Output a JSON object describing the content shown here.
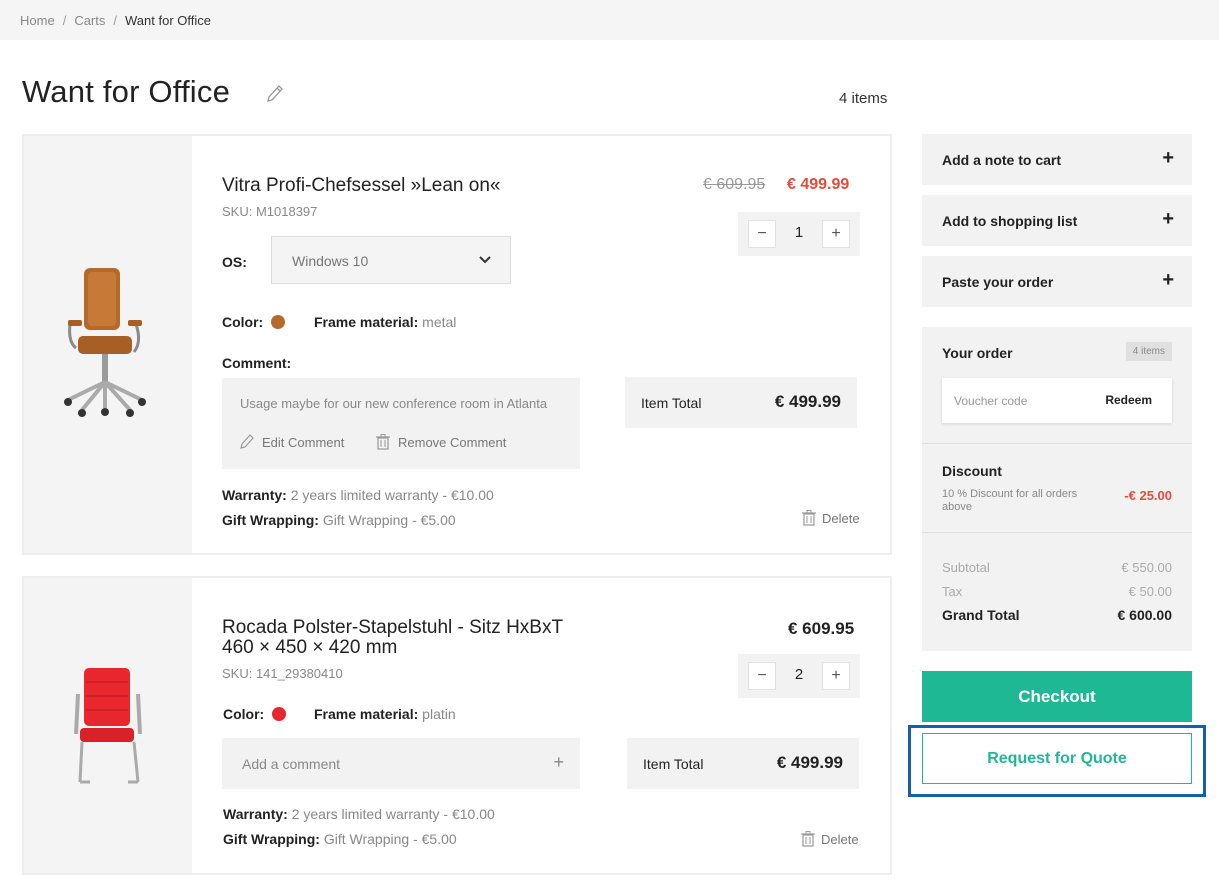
{
  "breadcrumb": [
    "Home",
    "Carts",
    "Want for Office"
  ],
  "page": {
    "title": "Want for Office",
    "items_count": "4 items"
  },
  "items": [
    {
      "name": "Vitra Profi-Chefsessel »Lean on«",
      "sku": "SKU: M1018397",
      "price_old": "€ 609.95",
      "price": "€ 499.99",
      "qty": "1",
      "os_label": "OS:",
      "os_value": "Windows 10",
      "color_label": "Color:",
      "color_hex": "#b5692a",
      "frame_label": "Frame material:",
      "frame_value": "metal",
      "comment_label": "Comment:",
      "comment_text": "Usage maybe for our new conference room in Atlanta",
      "edit_comment": "Edit Comment",
      "remove_comment": "Remove Comment",
      "item_total_label": "Item Total",
      "item_total": "€ 499.99",
      "warranty_label": "Warranty:",
      "warranty_value": "2 years limited warranty - €10.00",
      "gift_label": "Gift Wrapping:",
      "gift_value": "Gift Wrapping - €5.00",
      "delete": "Delete"
    },
    {
      "name_line1": "Rocada Polster-Stapelstuhl - Sitz HxBxT",
      "name_line2": "460 × 450 × 420 mm",
      "sku": "SKU: 141_29380410",
      "price": "€ 609.95",
      "qty": "2",
      "color_label": "Color:",
      "color_hex": "#e8262e",
      "frame_label": "Frame material:",
      "frame_value": "platin",
      "add_comment": "Add a comment",
      "item_total_label": "Item Total",
      "item_total": "€ 499.99",
      "warranty_label": "Warranty:",
      "warranty_value": "2 years limited warranty - €10.00",
      "gift_label": "Gift Wrapping:",
      "gift_value": "Gift Wrapping - €5.00",
      "delete": "Delete"
    }
  ],
  "sidebar": {
    "accordions": [
      "Add a note to cart",
      "Add to shopping list",
      "Paste your order"
    ],
    "order": {
      "title": "Your order",
      "count": "4 items",
      "voucher_placeholder": "Voucher code",
      "redeem": "Redeem",
      "discount_title": "Discount",
      "discount_desc": "10 % Discount for all orders above",
      "discount_value": "-€ 25.00",
      "subtotal_label": "Subtotal",
      "subtotal": "€ 550.00",
      "tax_label": "Tax",
      "tax": "€ 50.00",
      "grand_label": "Grand Total",
      "grand": "€ 600.00"
    },
    "checkout": "Checkout",
    "request_quote": "Request for Quote"
  },
  "colors": {
    "accent": "#1fb895",
    "sale": "#e84a3a",
    "highlight": "#1560a8"
  }
}
